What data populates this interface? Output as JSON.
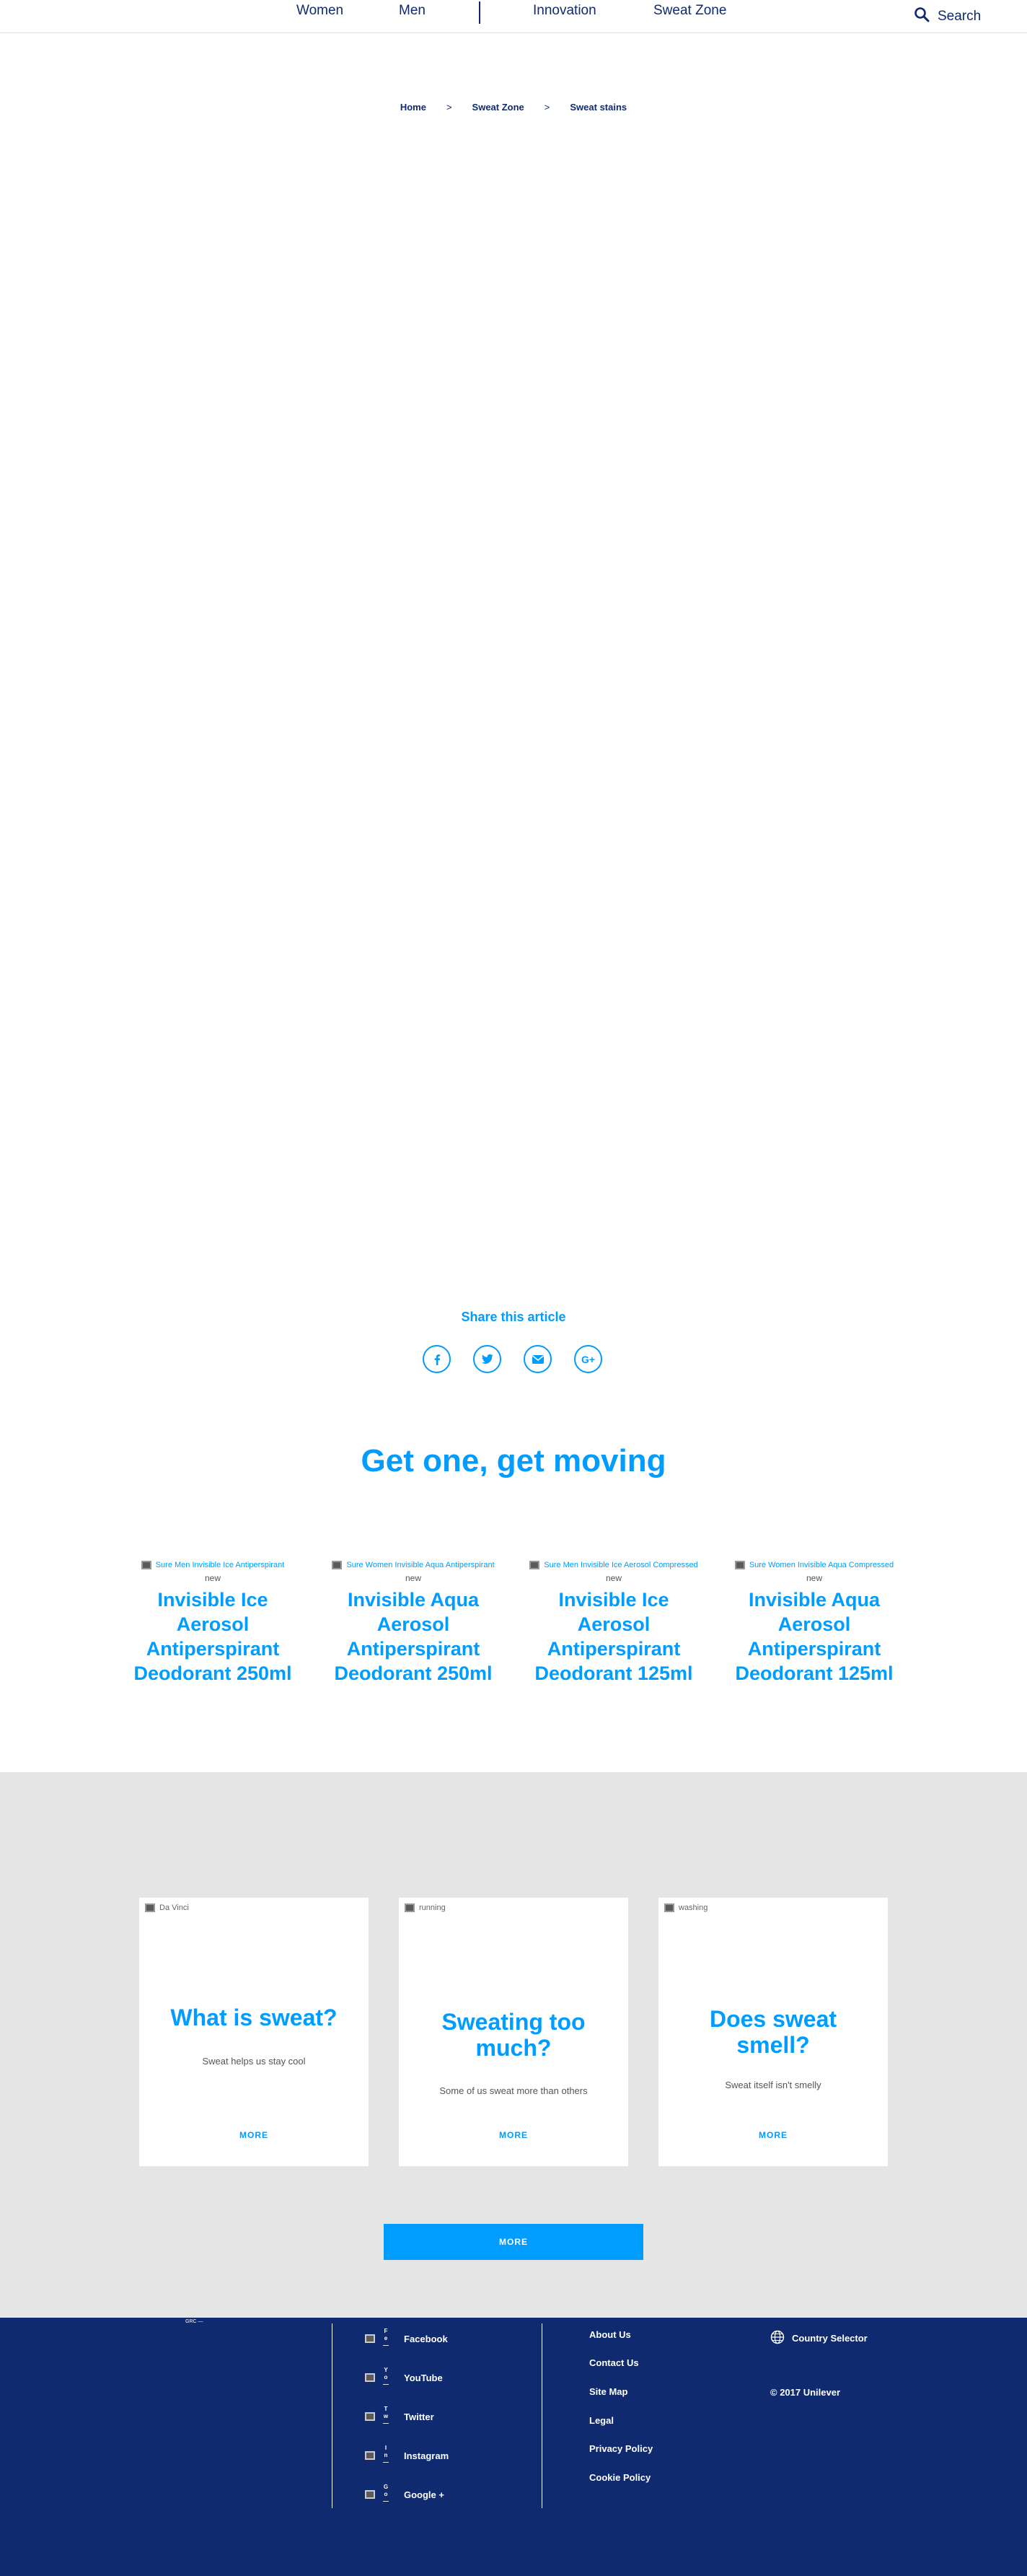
{
  "nav": {
    "women": "Women",
    "men": "Men",
    "innovation": "Innovation",
    "sweat_zone": "Sweat Zone",
    "search": "Search"
  },
  "breadcrumb": {
    "home": "Home",
    "sep1": ">",
    "sweat_zone": "Sweat Zone",
    "sep2": ">",
    "current": "Sweat stains"
  },
  "share": {
    "title": "Share this article",
    "icons": [
      "facebook-icon",
      "twitter-icon",
      "email-icon",
      "google-plus-icon"
    ]
  },
  "products": {
    "heading": "Get one, get moving",
    "items": [
      {
        "img_alt": "Sure Men Invisible Ice Antiperspirant",
        "badge": "new",
        "name": "Invisible Ice Aerosol Antiperspirant Deodorant 250ml"
      },
      {
        "img_alt": "Sure Women Invisible Aqua Antiperspirant",
        "badge": "new",
        "name": "Invisible Aqua Aerosol Antiperspirant Deodorant 250ml"
      },
      {
        "img_alt": "Sure Men Invisible Ice Aerosol Compressed",
        "badge": "new",
        "name": "Invisible Ice Aerosol Antiperspirant Deodorant 125ml"
      },
      {
        "img_alt": "Sure Women Invisible Aqua Compressed",
        "badge": "new",
        "name": "Invisible Aqua Aerosol Antiperspirant Deodorant 125ml"
      }
    ]
  },
  "articles": {
    "items": [
      {
        "tag": "Da Vinci",
        "title": "What is sweat?",
        "sub": "Sweat helps us stay cool",
        "more": "MORE"
      },
      {
        "tag": "running",
        "title": "Sweating too much?",
        "sub": "Some of us sweat more than others",
        "more": "MORE"
      },
      {
        "tag": "washing",
        "title": "Does sweat smell?",
        "sub": "Sweat itself isn't smelly",
        "more": "MORE"
      }
    ],
    "more_button": "MORE"
  },
  "footer": {
    "tiny_text": "GRC —",
    "social": [
      {
        "letters": "F\ne\n—",
        "label": "Facebook"
      },
      {
        "letters": "Y\no\n—",
        "label": "YouTube"
      },
      {
        "letters": "T\nw\n—",
        "label": "Twitter"
      },
      {
        "letters": "I\nn\n—",
        "label": "Instagram"
      },
      {
        "letters": "G\no\n—",
        "label": "Google +"
      }
    ],
    "links": [
      "About Us",
      "Contact Us",
      "Site Map",
      "Legal",
      "Privacy Policy",
      "Cookie Policy"
    ],
    "country_selector": "Country Selector",
    "copyright": "© 2017 Unilever"
  },
  "colors": {
    "navy": "#0f2a6e",
    "accent_blue": "#009cff",
    "gray_bg": "#e5e5e5"
  }
}
